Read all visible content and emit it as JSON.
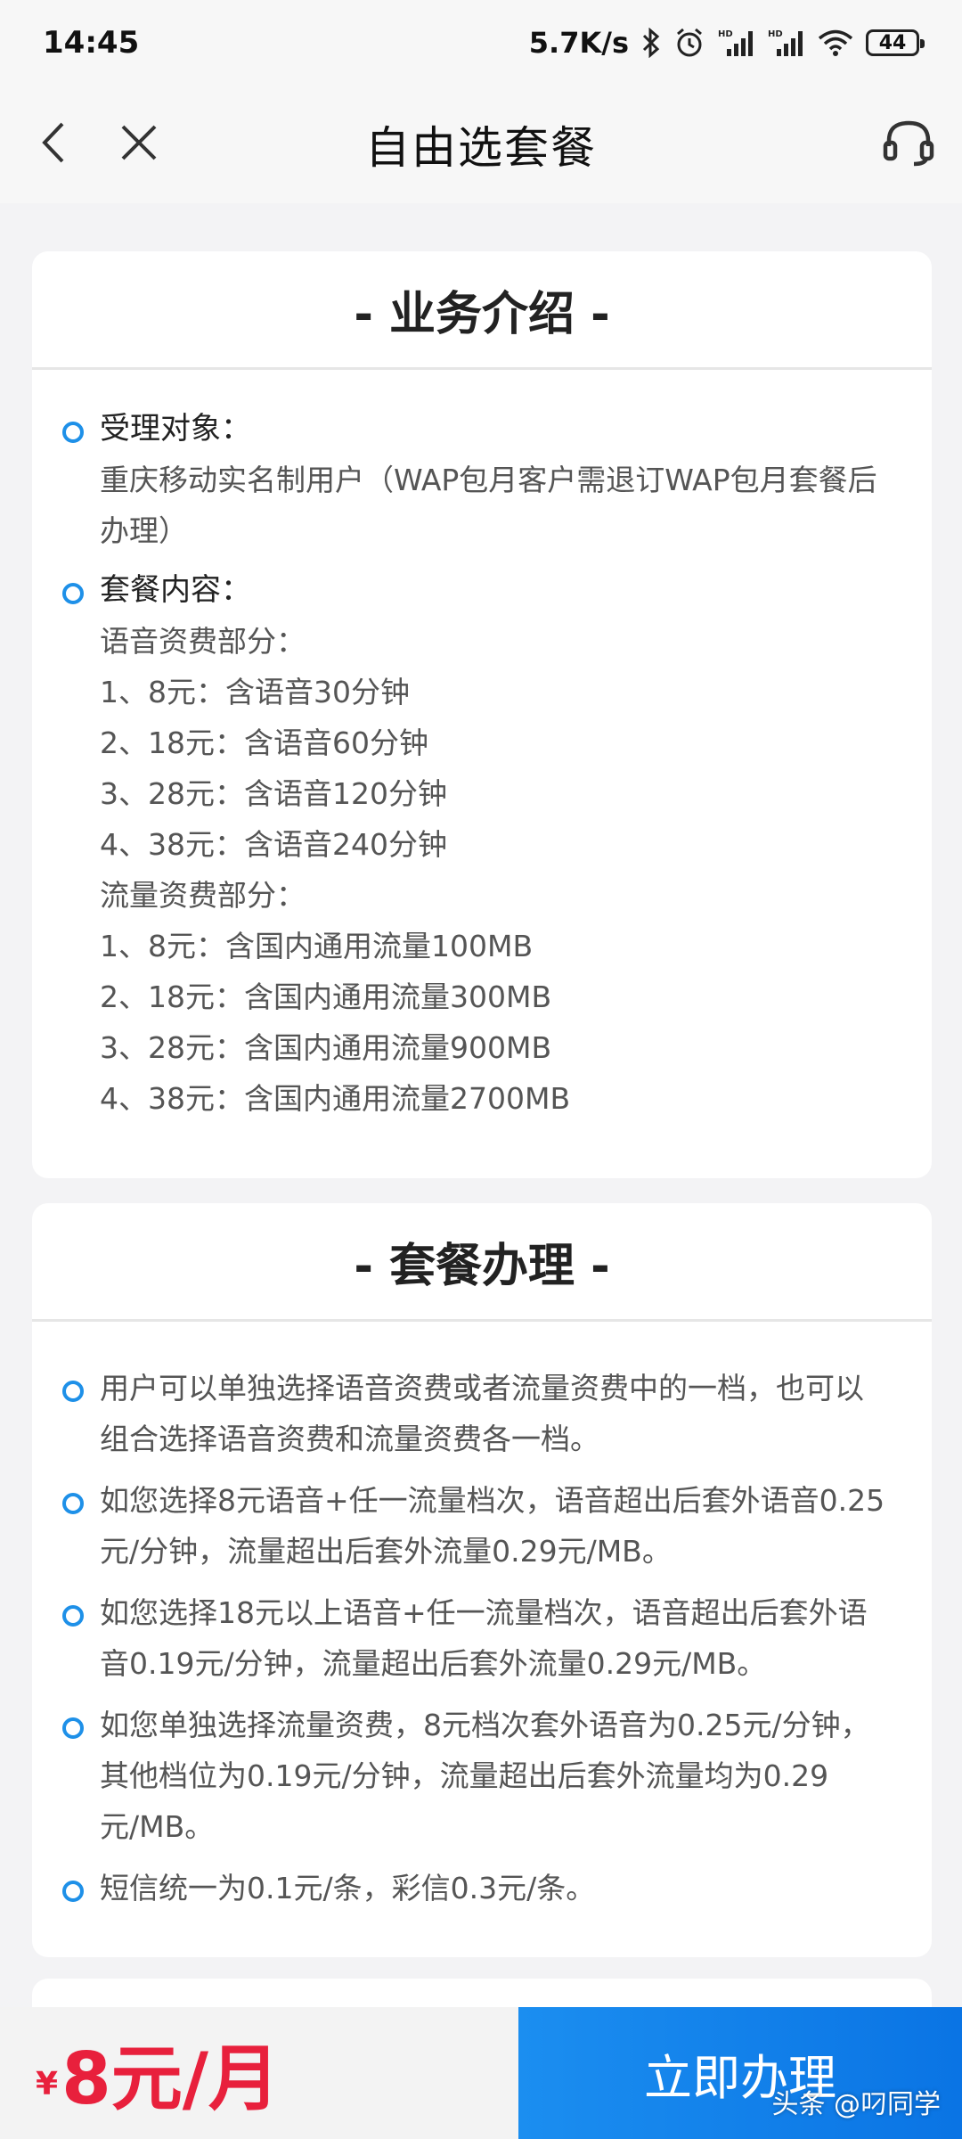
{
  "status_bar": {
    "time": "14:45",
    "net_speed": "5.7K/s",
    "battery": "44",
    "icons": [
      "bluetooth-icon",
      "alarm-icon",
      "signal-hd-icon",
      "signal-hd-icon",
      "wifi-icon",
      "battery-icon"
    ]
  },
  "header": {
    "title": "自由选套餐",
    "icons": [
      "back-icon",
      "close-icon",
      "customer-service-icon"
    ]
  },
  "intro": {
    "title": "- 业务介绍 -",
    "target_label": "受理对象：",
    "target_text": "重庆移动实名制用户（WAP包月客户需退订WAP包月套餐后办理）",
    "content_label": "套餐内容：",
    "voice_heading": "语音资费部分：",
    "voice_items": [
      "1、8元：含语音30分钟",
      "2、18元：含语音60分钟",
      "3、28元：含语音120分钟",
      "4、38元：含语音240分钟"
    ],
    "data_heading": "流量资费部分：",
    "data_items": [
      "1、8元：含国内通用流量100MB",
      "2、18元：含国内通用流量300MB",
      "3、28元：含国内通用流量900MB",
      "4、38元：含国内通用流量2700MB"
    ]
  },
  "handling": {
    "title": "- 套餐办理 -",
    "items": [
      "用户可以单独选择语音资费或者流量资费中的一档，也可以组合选择语音资费和流量资费各一档。",
      "如您选择8元语音+任一流量档次，语音超出后套外语音0.25元/分钟，流量超出后套外流量0.29元/MB。",
      "如您选择18元以上语音+任一流量档次，语音超出后套外语音0.19元/分钟，流量超出后套外流量0.29元/MB。",
      "如您单独选择流量资费，8元档次套外语音为0.25元/分钟，其他档位为0.19元/分钟，流量超出后套外流量均为0.29元/MB。",
      "短信统一为0.1元/条，彩信0.3元/条。"
    ]
  },
  "bottom": {
    "currency": "¥",
    "price": "8元/月",
    "action": "立即办理",
    "watermark": "头条 @叼同学"
  },
  "colors": {
    "accent": "#1e90e8",
    "price": "#e8203c",
    "cta": "#0a74e4"
  }
}
